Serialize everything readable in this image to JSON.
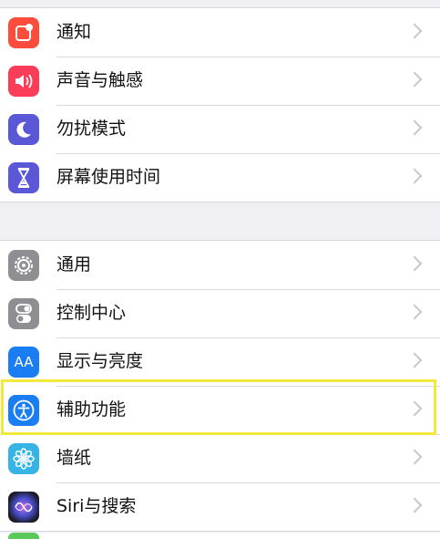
{
  "group1": [
    {
      "label": "通知",
      "icon": "notifications-icon",
      "color": "#fc4c3c"
    },
    {
      "label": "声音与触感",
      "icon": "speaker-icon",
      "color": "#fc3d5a"
    },
    {
      "label": "勿扰模式",
      "icon": "moon-icon",
      "color": "#5a58d6"
    },
    {
      "label": "屏幕使用时间",
      "icon": "hourglass-icon",
      "color": "#5a58d6"
    }
  ],
  "group2": [
    {
      "label": "通用",
      "icon": "gear-icon",
      "color": "#8e8e93"
    },
    {
      "label": "控制中心",
      "icon": "toggle-switches-icon",
      "color": "#8e8e93"
    },
    {
      "label": "显示与亮度",
      "icon": "text-size-icon",
      "color": "#1a7ef2"
    },
    {
      "label": "辅助功能",
      "icon": "accessibility-icon",
      "color": "#1a7ef2"
    },
    {
      "label": "墙纸",
      "icon": "flower-icon",
      "color": "#36b4e6"
    },
    {
      "label": "Siri与搜索",
      "icon": "siri-icon",
      "color": "#2a2a3a"
    }
  ],
  "icons": {
    "text_size_glyph": "AA"
  },
  "highlighted_item": "辅助功能"
}
